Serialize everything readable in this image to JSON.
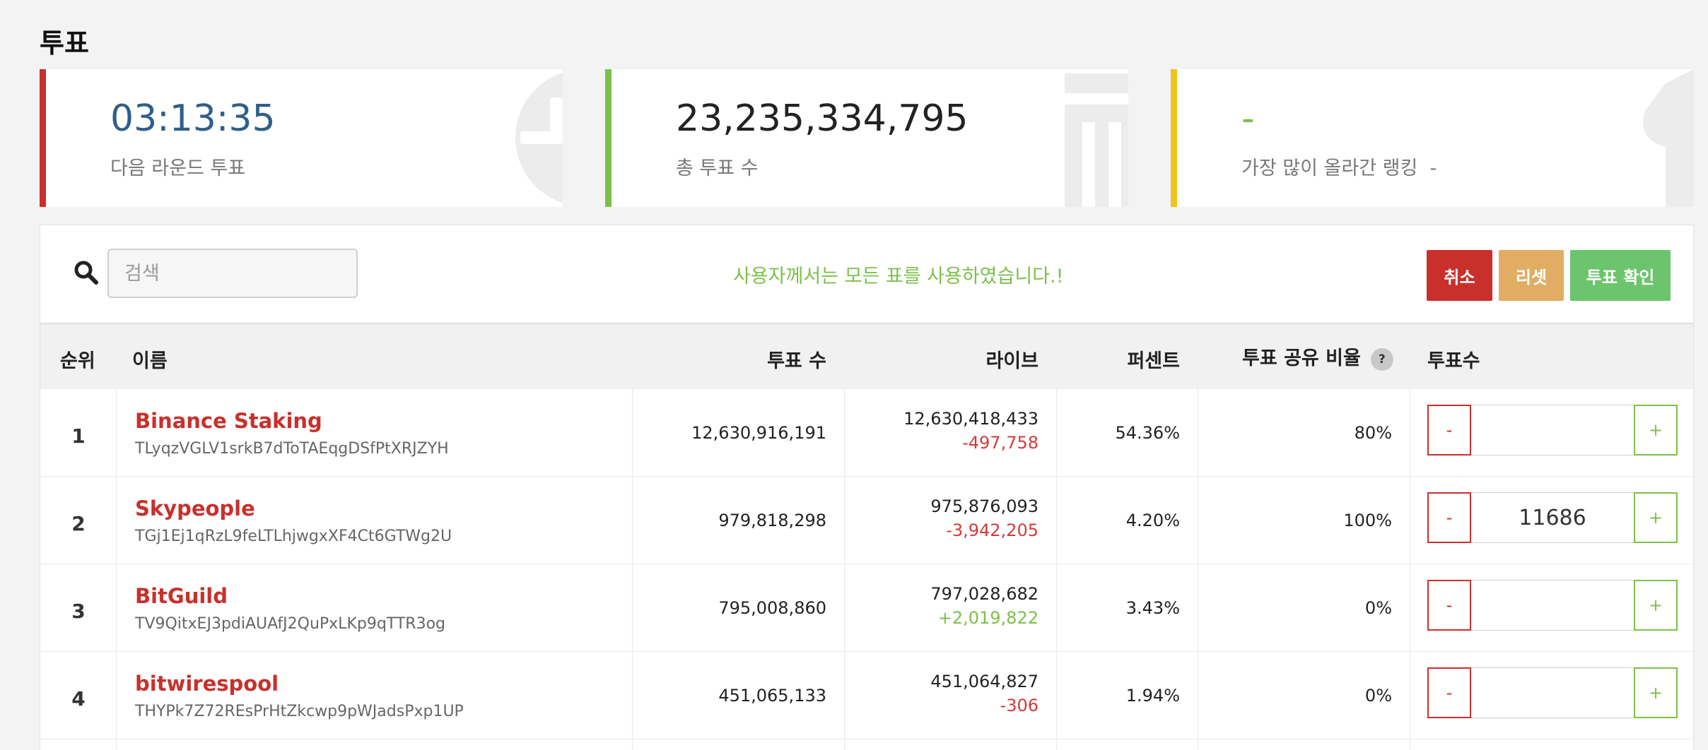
{
  "page": {
    "title": "투표"
  },
  "stats": {
    "timer": {
      "value": "03:13:35",
      "label": "다음 라운드 투표",
      "accent": "#c9302c",
      "value_color": "#2f5f8a"
    },
    "total": {
      "value": "23,235,334,795",
      "label": "총 투표 수",
      "accent": "#7cc04b"
    },
    "ranking": {
      "value": "-",
      "label": "가장 많이 올라간 랭킹",
      "label_suffix": "-",
      "accent": "#f0c419"
    }
  },
  "toolbar": {
    "search_placeholder": "검색",
    "notice": "사용자께서는 모든 표를 사용하였습니다.!",
    "cancel_label": "취소",
    "reset_label": "리셋",
    "confirm_label": "투표 확인"
  },
  "table": {
    "headers": {
      "rank": "순위",
      "name": "이름",
      "votes": "투표 수",
      "live": "라이브",
      "percent": "퍼센트",
      "share": "투표 공유 비율",
      "help": "?",
      "my_votes": "투표수"
    },
    "rows": [
      {
        "rank": "1",
        "name": "Binance Staking",
        "address": "TLyqzVGLV1srkB7dToTAEqgDSfPtXRJZYH",
        "votes": "12,630,916,191",
        "live": "12,630,418,433",
        "delta": "-497,758",
        "delta_sign": "neg",
        "percent": "54.36%",
        "share": "80%",
        "my_votes": ""
      },
      {
        "rank": "2",
        "name": "Skypeople",
        "address": "TGj1Ej1qRzL9feLTLhjwgxXF4Ct6GTWg2U",
        "votes": "979,818,298",
        "live": "975,876,093",
        "delta": "-3,942,205",
        "delta_sign": "neg",
        "percent": "4.20%",
        "share": "100%",
        "my_votes": "11686"
      },
      {
        "rank": "3",
        "name": "BitGuild",
        "address": "TV9QitxEJ3pdiAUAfJ2QuPxLKp9qTTR3og",
        "votes": "795,008,860",
        "live": "797,028,682",
        "delta": "+2,019,822",
        "delta_sign": "pos",
        "percent": "3.43%",
        "share": "0%",
        "my_votes": ""
      },
      {
        "rank": "4",
        "name": "bitwirespool",
        "address": "THYPk7Z72REsPrHtZkcwp9pWJadsPxp1UP",
        "votes": "451,065,133",
        "live": "451,064,827",
        "delta": "-306",
        "delta_sign": "neg",
        "percent": "1.94%",
        "share": "0%",
        "my_votes": ""
      }
    ],
    "minus_label": "-",
    "plus_label": "+"
  }
}
